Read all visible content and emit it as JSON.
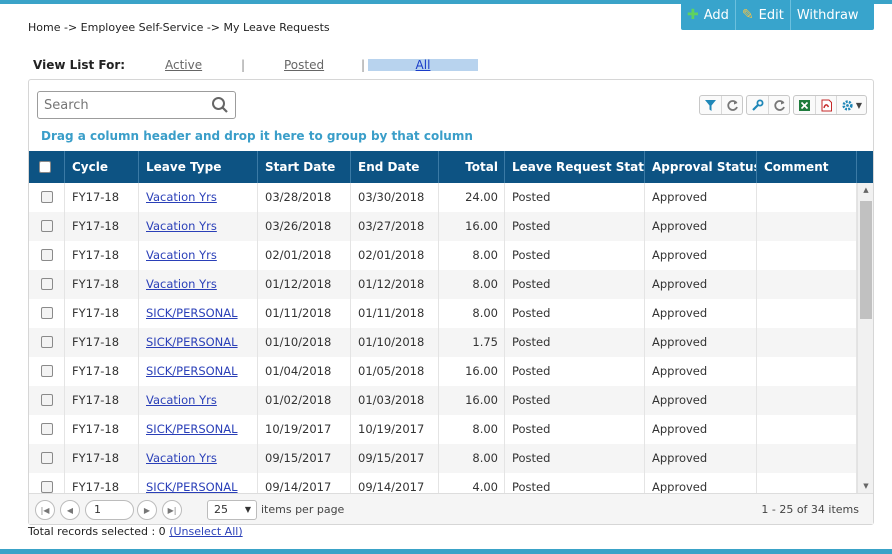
{
  "breadcrumb": "Home -> Employee Self-Service -> My Leave Requests",
  "actions": {
    "add": "Add",
    "edit": "Edit",
    "withdraw": "Withdraw"
  },
  "view_list": {
    "label": "View List For:",
    "active": "Active",
    "posted": "Posted",
    "all": "All",
    "separator": "|"
  },
  "search": {
    "placeholder": "Search",
    "value": ""
  },
  "group_hint": "Drag a column header and drop it here to group by that column",
  "columns": [
    "Cycle",
    "Leave Type",
    "Start Date",
    "End Date",
    "Total",
    "Leave Request Status",
    "Approval Status",
    "Comment"
  ],
  "sort_indicator": "↓",
  "rows": [
    {
      "cycle": "FY17-18",
      "leave_type": "Vacation Yrs",
      "start": "03/28/2018",
      "end": "03/30/2018",
      "total": "24.00",
      "status": "Posted",
      "approval": "Approved",
      "comment": ""
    },
    {
      "cycle": "FY17-18",
      "leave_type": "Vacation Yrs",
      "start": "03/26/2018",
      "end": "03/27/2018",
      "total": "16.00",
      "status": "Posted",
      "approval": "Approved",
      "comment": ""
    },
    {
      "cycle": "FY17-18",
      "leave_type": "Vacation Yrs",
      "start": "02/01/2018",
      "end": "02/01/2018",
      "total": "8.00",
      "status": "Posted",
      "approval": "Approved",
      "comment": ""
    },
    {
      "cycle": "FY17-18",
      "leave_type": "Vacation Yrs",
      "start": "01/12/2018",
      "end": "01/12/2018",
      "total": "8.00",
      "status": "Posted",
      "approval": "Approved",
      "comment": ""
    },
    {
      "cycle": "FY17-18",
      "leave_type": "SICK/PERSONAL",
      "start": "01/11/2018",
      "end": "01/11/2018",
      "total": "8.00",
      "status": "Posted",
      "approval": "Approved",
      "comment": ""
    },
    {
      "cycle": "FY17-18",
      "leave_type": "SICK/PERSONAL",
      "start": "01/10/2018",
      "end": "01/10/2018",
      "total": "1.75",
      "status": "Posted",
      "approval": "Approved",
      "comment": ""
    },
    {
      "cycle": "FY17-18",
      "leave_type": "SICK/PERSONAL",
      "start": "01/04/2018",
      "end": "01/05/2018",
      "total": "16.00",
      "status": "Posted",
      "approval": "Approved",
      "comment": ""
    },
    {
      "cycle": "FY17-18",
      "leave_type": "Vacation Yrs",
      "start": "01/02/2018",
      "end": "01/03/2018",
      "total": "16.00",
      "status": "Posted",
      "approval": "Approved",
      "comment": ""
    },
    {
      "cycle": "FY17-18",
      "leave_type": "SICK/PERSONAL",
      "start": "10/19/2017",
      "end": "10/19/2017",
      "total": "8.00",
      "status": "Posted",
      "approval": "Approved",
      "comment": ""
    },
    {
      "cycle": "FY17-18",
      "leave_type": "Vacation Yrs",
      "start": "09/15/2017",
      "end": "09/15/2017",
      "total": "8.00",
      "status": "Posted",
      "approval": "Approved",
      "comment": ""
    },
    {
      "cycle": "FY17-18",
      "leave_type": "SICK/PERSONAL",
      "start": "09/14/2017",
      "end": "09/14/2017",
      "total": "4.00",
      "status": "Posted",
      "approval": "Approved",
      "comment": ""
    }
  ],
  "pager": {
    "page": "1",
    "page_size": "25",
    "items_per_page": "items per page",
    "info": "1 - 25 of 34 items"
  },
  "selection": {
    "text": "Total records selected : 0",
    "unselect": "(Unselect All)"
  },
  "colors": {
    "accent": "#38a4cc",
    "header": "#0d5383",
    "link": "#2a3fb8"
  },
  "icons": [
    "plus-icon",
    "pencil-icon",
    "search-icon",
    "filter-icon",
    "refresh-icon",
    "wrench-icon",
    "excel-icon",
    "pdf-icon",
    "gear-icon"
  ]
}
